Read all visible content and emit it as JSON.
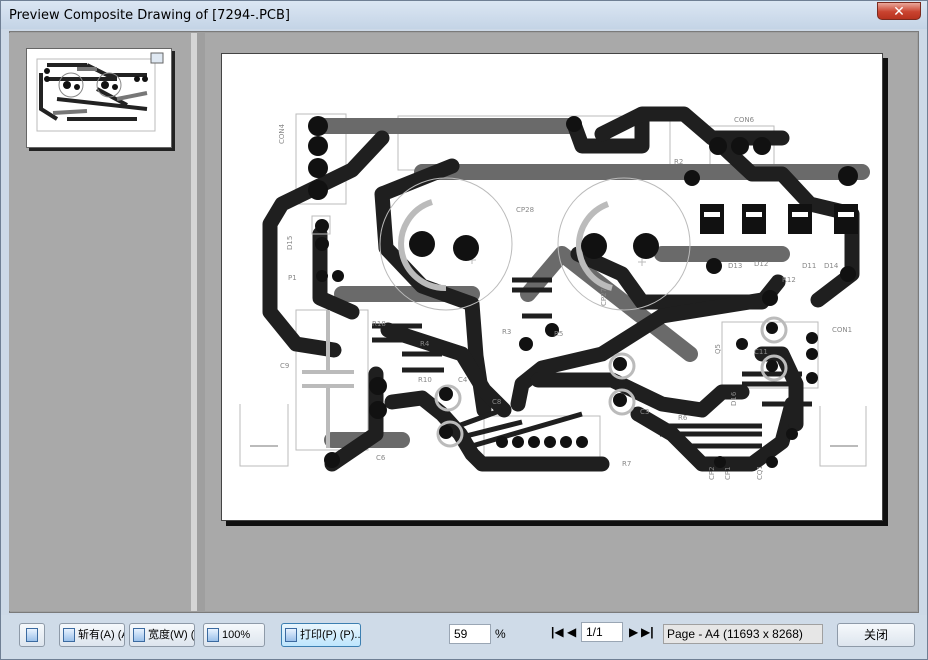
{
  "window": {
    "title": "Preview Composite Drawing of [7294-.PCB]",
    "close_glyph": "✕"
  },
  "toolbar": {
    "buttons": [
      {
        "label": ""
      },
      {
        "label": "斩有(A) (A"
      },
      {
        "label": "宽度(W) (W"
      },
      {
        "label": "100%"
      },
      {
        "label": "打印(P) (P)..."
      }
    ],
    "zoom_value": "59",
    "zoom_unit": "%",
    "page_value": "1/1",
    "page_info": "Page - A4 (11693 x 8268)",
    "close_label": "关闭"
  },
  "pcb_labels": {
    "con4": "CON4",
    "con6": "CON6",
    "con1": "CON1",
    "cp28": "CP28",
    "cp27": "CP27",
    "r2": "R2",
    "r3": "R3",
    "r4": "R4",
    "r5": "R5",
    "r6": "R6",
    "r7": "R7",
    "r10": "R10",
    "r12": "R12",
    "r18": "R18",
    "c3": "C3",
    "c4": "C4",
    "c6": "C6",
    "c8": "C8",
    "c9": "C9",
    "c11": "C11",
    "d11": "D11",
    "d12": "D12",
    "d13": "D13",
    "d14": "D14",
    "d15": "D15",
    "p1": "P1",
    "q5": "Q5",
    "d16": "D16",
    "cp2": "CP2",
    "cp1": "CP1",
    "cq1": "CQ1"
  },
  "colors": {
    "trace_dark": "#1f1f1f",
    "trace_mid": "#6a6a6a",
    "pad": "#111111",
    "silk": "#bdbdbd"
  }
}
